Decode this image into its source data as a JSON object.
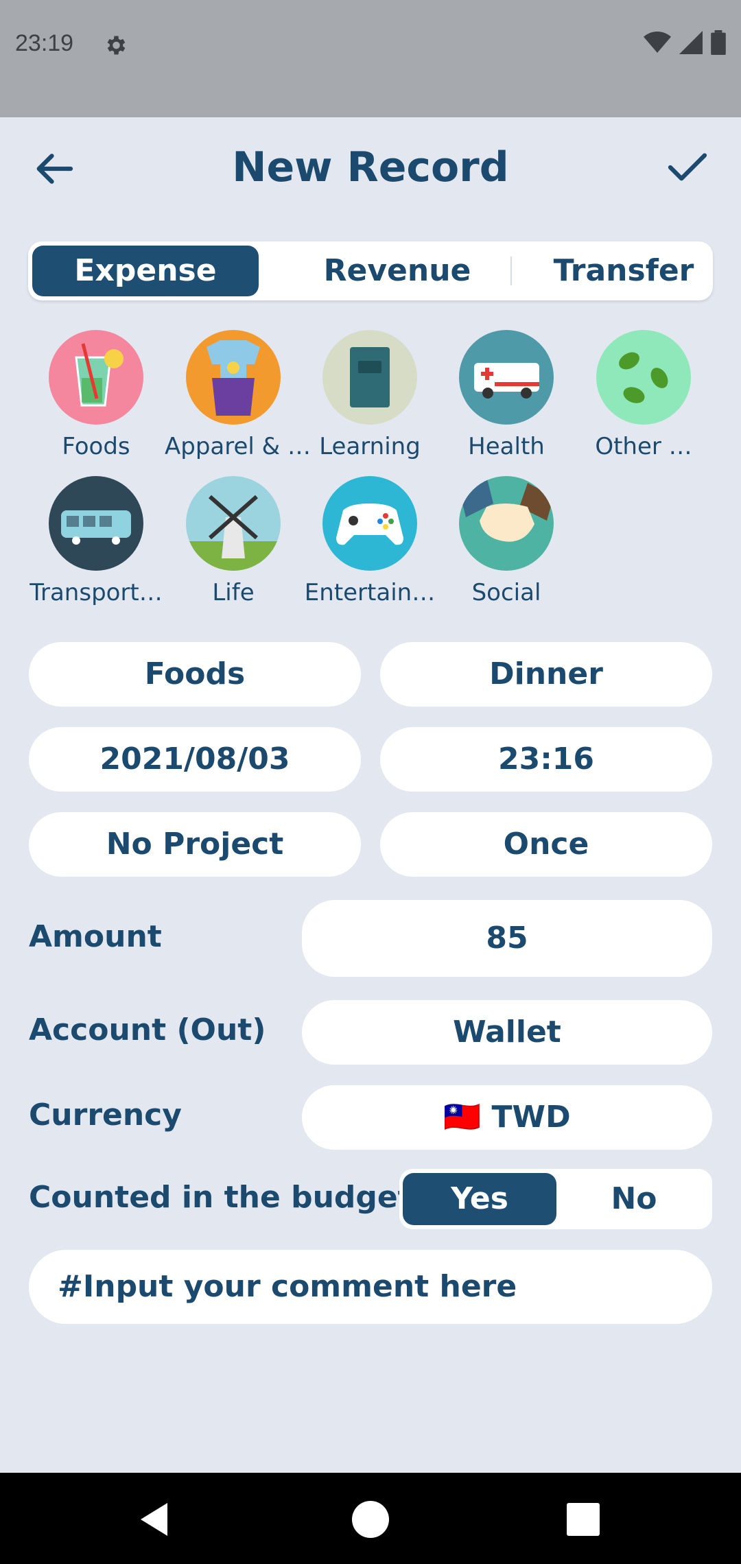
{
  "status": {
    "time": "23:19"
  },
  "header": {
    "title": "New Record"
  },
  "tabs": {
    "expense": "Expense",
    "revenue": "Revenue",
    "transfer": "Transfer"
  },
  "categories": [
    {
      "label": "Foods",
      "icon": "drink-glass-icon",
      "color": "#F4879E"
    },
    {
      "label": "Apparel & …",
      "icon": "clothes-icon",
      "color": "#F29A2E"
    },
    {
      "label": "Learning",
      "icon": "book-icon",
      "color": "#D7DCC6"
    },
    {
      "label": "Health",
      "icon": "ambulance-icon",
      "color": "#4E9AA8"
    },
    {
      "label": "Other …",
      "icon": "leaves-icon",
      "color": "#8FE8B9"
    },
    {
      "label": "Transport…",
      "icon": "bus-icon",
      "color": "#2F4858"
    },
    {
      "label": "Life",
      "icon": "windmill-icon",
      "color": "#9BD4DE"
    },
    {
      "label": "Entertain…",
      "icon": "gamepad-icon",
      "color": "#2DB7D4"
    },
    {
      "label": "Social",
      "icon": "handshake-icon",
      "color": "#4FB3A3"
    }
  ],
  "fields": {
    "category": "Foods",
    "subcategory": "Dinner",
    "date": "2021/08/03",
    "time": "23:16",
    "project": "No Project",
    "repeat": "Once"
  },
  "form": {
    "amount_label": "Amount",
    "amount_value": "85",
    "account_label": "Account (Out)",
    "account_value": "Wallet",
    "currency_label": "Currency",
    "currency_flag": "🇹🇼",
    "currency_value": "TWD",
    "budget_label": "Counted in the budget",
    "budget_yes": "Yes",
    "budget_no": "No",
    "comment_placeholder": "#Input your comment here"
  },
  "colors": {
    "accent": "#1F4E73",
    "background": "#E3E8F0"
  }
}
